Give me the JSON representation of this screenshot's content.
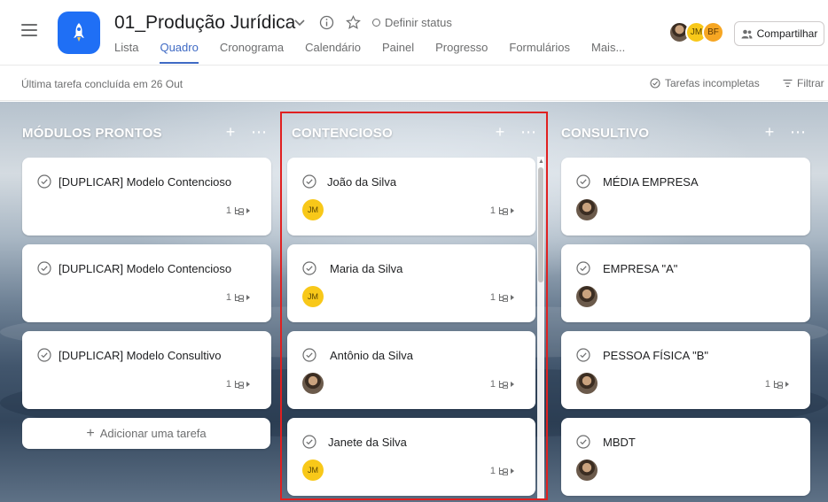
{
  "header": {
    "project_title": "01_Produção Jurídica",
    "status_label": "Definir status",
    "share_label": "Compartilhar",
    "avatars": [
      {
        "type": "photo",
        "initials": ""
      },
      {
        "type": "jm",
        "initials": "JM"
      },
      {
        "type": "bf",
        "initials": "BF"
      }
    ],
    "tabs": [
      {
        "label": "Lista",
        "active": false
      },
      {
        "label": "Quadro",
        "active": true
      },
      {
        "label": "Cronograma",
        "active": false
      },
      {
        "label": "Calendário",
        "active": false
      },
      {
        "label": "Painel",
        "active": false
      },
      {
        "label": "Progresso",
        "active": false
      },
      {
        "label": "Formulários",
        "active": false
      },
      {
        "label": "Mais...",
        "active": false
      }
    ]
  },
  "subbar": {
    "last_task": "Última tarefa concluída em 26 Out",
    "incomplete_label": "Tarefas incompletas",
    "filter_label": "Filtrar"
  },
  "columns": [
    {
      "title": "MÓDULOS PRONTOS",
      "add_task_label": "Adicionar uma tarefa",
      "cards": [
        {
          "name": "[DUPLICAR] Modelo Contencioso",
          "subtasks": "1",
          "assignee": "none"
        },
        {
          "name": "[DUPLICAR] Modelo Contencioso",
          "subtasks": "1",
          "assignee": "none"
        },
        {
          "name": "[DUPLICAR] Modelo Consultivo",
          "subtasks": "1",
          "assignee": "none"
        }
      ]
    },
    {
      "title": "CONTENCIOSO",
      "cards": [
        {
          "name": "João da Silva",
          "subtasks": "1",
          "assignee": "JM"
        },
        {
          "name": "Maria da Silva",
          "subtasks": "1",
          "assignee": "JM"
        },
        {
          "name": "Antônio da Silva",
          "subtasks": "1",
          "assignee": "photo"
        },
        {
          "name": "Janete da Silva",
          "subtasks": "1",
          "assignee": "JM"
        }
      ]
    },
    {
      "title": "CONSULTIVO",
      "cards": [
        {
          "name": "MÉDIA EMPRESA",
          "subtasks": "",
          "assignee": "photo"
        },
        {
          "name": "EMPRESA \"A\"",
          "subtasks": "",
          "assignee": "photo"
        },
        {
          "name": "PESSOA FÍSICA \"B\"",
          "subtasks": "1",
          "assignee": "photo"
        },
        {
          "name": "MBDT",
          "subtasks": "",
          "assignee": "photo"
        }
      ]
    }
  ],
  "colors": {
    "accent": "#3f6ac4",
    "project_icon": "#1f6ff5",
    "highlight": "#e02020",
    "jm_avatar": "#f8c819",
    "bf_avatar": "#f6a623"
  },
  "icons": {
    "menu": "hamburger-icon",
    "project": "rocket-icon",
    "dropdown": "chevron-down-icon",
    "info": "info-icon",
    "favorite": "star-icon",
    "check": "check-circle-icon",
    "subtask": "subtask-icon",
    "add": "plus-icon",
    "more": "more-icon",
    "filter": "filter-icon",
    "share": "people-icon"
  }
}
